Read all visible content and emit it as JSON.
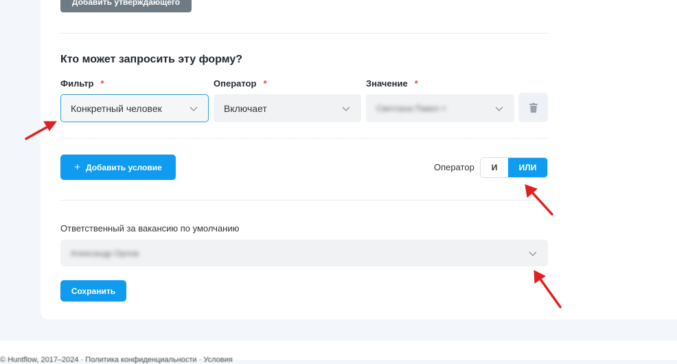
{
  "form": {
    "add_approver_label": "Добавить утверждающего",
    "section_title": "Кто может запросить эту форму?",
    "filter": {
      "label": "Фильтр",
      "required_mark": "*",
      "value": "Конкретный человек"
    },
    "operator_field": {
      "label": "Оператор",
      "required_mark": "*",
      "value": "Включает"
    },
    "value_field": {
      "label": "Значение",
      "required_mark": "*",
      "value": "Светлана Павел ×"
    },
    "add_condition_label": "Добавить условие",
    "add_condition_icon": "+",
    "operator_toggle": {
      "label": "Оператор",
      "options": [
        "И",
        "ИЛИ"
      ],
      "selected": "ИЛИ"
    },
    "responsible": {
      "label": "Ответственный за вакансию по умолчанию",
      "value": "Александр Орлов"
    },
    "save_label": "Сохранить"
  },
  "footer": {
    "text": "© Huntflow, 2017–2024 · Политика конфиденциальности · Условия"
  },
  "colors": {
    "primary": "#0f9cf0",
    "gray_button": "#6f7b84",
    "required": "#e5484d",
    "annotation_arrow": "#e02020"
  },
  "icons": {
    "trash": "trash-icon",
    "chevron": "chevron-down-icon",
    "plus": "plus-icon"
  }
}
